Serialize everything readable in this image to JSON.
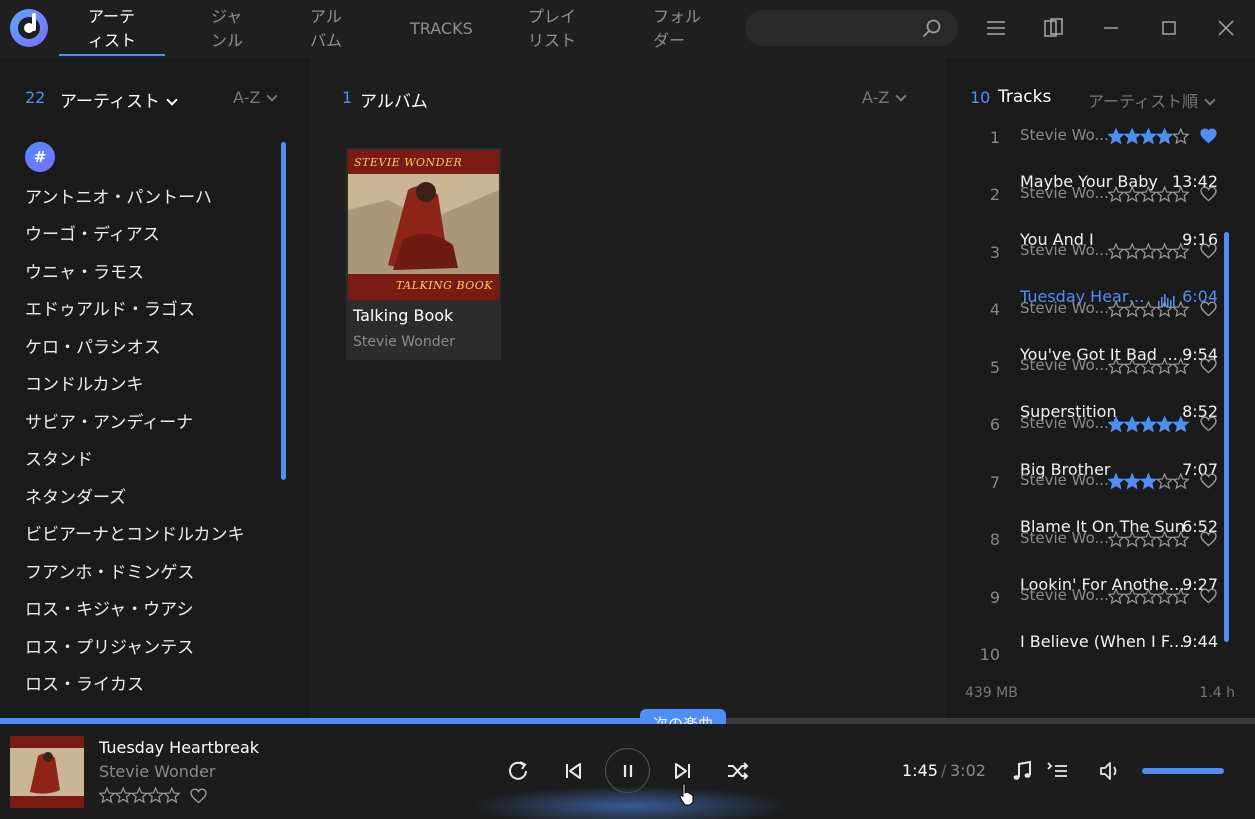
{
  "nav": {
    "tabs": [
      {
        "label": "アーテ\nィスト"
      },
      {
        "label": "ジャ\nンル"
      },
      {
        "label": "アル\nバム"
      },
      {
        "label": "TRACKS"
      },
      {
        "label": "プレイ\nリスト"
      },
      {
        "label": "フォル\nダー"
      }
    ],
    "search_placeholder": ""
  },
  "artists_panel": {
    "count": "22",
    "title": "アーティスト",
    "sort": "A-Z",
    "badge": "#",
    "items": [
      "アントニオ・パントーハ",
      "ウーゴ・ディアス",
      "ウニャ・ラモス",
      "エドゥアルド・ラゴス",
      "ケロ・パラシオス",
      "コンドルカンキ",
      "サビア・アンディーナ",
      "スタンド",
      "ネタンダーズ",
      "ビビアーナとコンドルカンキ",
      "フアンホ・ドミンゲス",
      "ロス・キジャ・ウアシ",
      "ロス・プリジャンテス",
      "ロス・ライカス"
    ]
  },
  "albums_panel": {
    "count": "1",
    "title": "アルバム",
    "sort": "A-Z",
    "albums": [
      {
        "title": "Talking Book",
        "artist": "Stevie Wonder",
        "cover_top": "STEVIE WONDER",
        "cover_bottom": "TALKING BOOK"
      }
    ]
  },
  "tracks_panel": {
    "count": "10",
    "title": "Tracks",
    "sort": "アーティスト順",
    "size": "439 MB",
    "total_time": "1.4 h",
    "tracks": [
      {
        "num": "1",
        "title": "",
        "duration": "",
        "artist": "Stevie Wo...",
        "rating": 4,
        "favorite": true
      },
      {
        "num": "2",
        "title": "Maybe Your Baby",
        "duration": "13:42",
        "artist": "Stevie Wo...",
        "rating": 0,
        "favorite": false
      },
      {
        "num": "3",
        "title": "You And I",
        "duration": "9:16",
        "artist": "Stevie Wo...",
        "rating": 0,
        "favorite": false
      },
      {
        "num": "4",
        "title": "Tuesday Heart...",
        "duration": "6:04",
        "artist": "Stevie Wo...",
        "rating": 0,
        "favorite": false,
        "playing": true
      },
      {
        "num": "5",
        "title": "You've Got It Bad Girl",
        "duration": "9:54",
        "artist": "Stevie Wo...",
        "rating": 0,
        "favorite": false
      },
      {
        "num": "6",
        "title": "Superstition",
        "duration": "8:52",
        "artist": "Stevie Wo...",
        "rating": 5,
        "favorite": false
      },
      {
        "num": "7",
        "title": "Big Brother",
        "duration": "7:07",
        "artist": "Stevie Wo...",
        "rating": 3,
        "favorite": false
      },
      {
        "num": "8",
        "title": "Blame It On The Sun",
        "duration": "6:52",
        "artist": "Stevie Wo...",
        "rating": 0,
        "favorite": false
      },
      {
        "num": "9",
        "title": "Lookin' For Another...",
        "duration": "9:27",
        "artist": "Stevie Wo...",
        "rating": 0,
        "favorite": false
      },
      {
        "num": "10",
        "title": "I Believe (When I Fal...",
        "duration": "9:44",
        "artist": "",
        "rating": 0,
        "favorite": false
      }
    ]
  },
  "player": {
    "title": "Tuesday Heartbreak",
    "artist": "Stevie Wonder",
    "rating": 0,
    "tooltip": "次の楽曲",
    "current_time": "1:45",
    "separator": "/",
    "total_time": "3:02",
    "progress_fraction": 0.577,
    "volume_fraction": 1.0
  },
  "colors": {
    "accent": "#4f8ef7",
    "background": "#1b1b1b",
    "muted_text": "#8a8a8a"
  },
  "icons": [
    "app-logo-icon",
    "search-icon",
    "menu-icon",
    "mini-player-icon",
    "minimize-icon",
    "maximize-icon",
    "close-icon",
    "repeat-icon",
    "previous-icon",
    "pause-icon",
    "next-icon",
    "shuffle-icon",
    "music-note-icon",
    "queue-icon",
    "volume-icon",
    "star-icon",
    "heart-icon",
    "equalizer-icon"
  ]
}
